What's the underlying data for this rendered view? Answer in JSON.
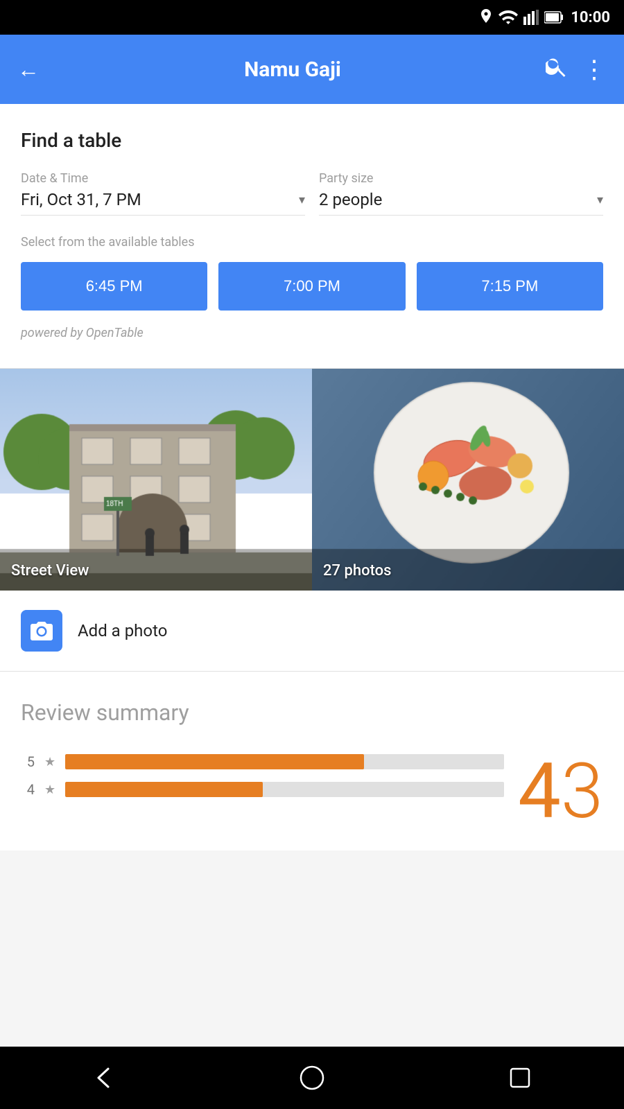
{
  "status_bar": {
    "time": "10:00"
  },
  "app_bar": {
    "title": "Namu Gaji",
    "back_label": "←",
    "search_label": "search",
    "more_label": "⋮"
  },
  "find_table": {
    "title": "Find a table",
    "date_time_label": "Date & Time",
    "date_time_value": "Fri, Oct 31, 7 PM",
    "party_size_label": "Party size",
    "party_size_value": "2 people",
    "select_label": "Select from the available tables",
    "time_slots": [
      "6:45 PM",
      "7:00 PM",
      "7:15 PM"
    ],
    "powered_by": "powered by OpenTable"
  },
  "photos": {
    "street_view_label": "Street View",
    "photos_label": "27 photos"
  },
  "add_photo": {
    "label": "Add a photo"
  },
  "review_summary": {
    "title": "Review summary",
    "rating_main": "4",
    "rating_decimal": "3",
    "bars": [
      {
        "star": "5",
        "width": 68
      },
      {
        "star": "4",
        "width": 45
      }
    ]
  },
  "nav": {
    "back_label": "◁",
    "home_label": "○",
    "recents_label": "□"
  }
}
